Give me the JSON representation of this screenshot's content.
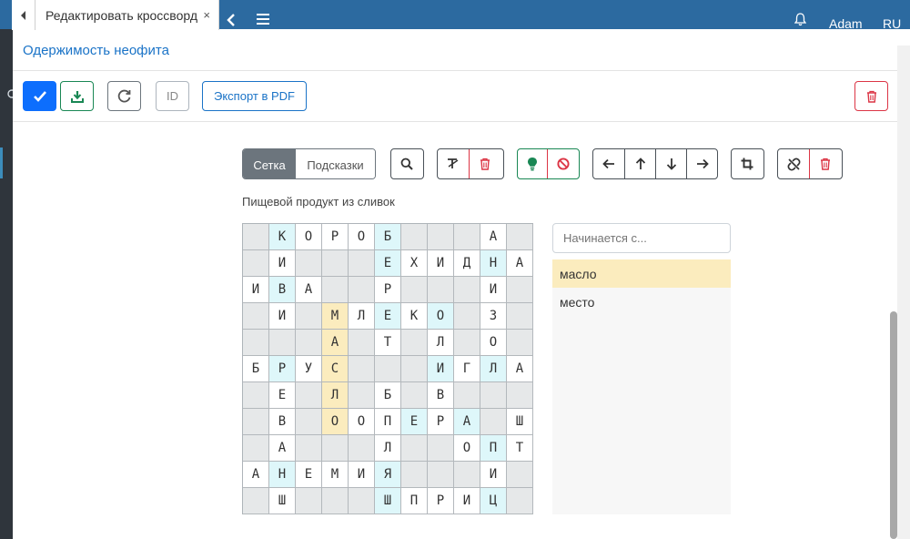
{
  "app": {
    "user": "Adam",
    "lang": "RU"
  },
  "tab": {
    "title": "Редактировать кроссворд",
    "close": "×"
  },
  "panel": {
    "title": "Одержимость неофита"
  },
  "actions": {
    "id_label": "ID",
    "export_label": "Экспорт в PDF"
  },
  "mode_tabs": {
    "grid": "Сетка",
    "hints": "Подсказки"
  },
  "clue": "Пищевой продукт из сливок",
  "search": {
    "placeholder": "Начинается с..."
  },
  "suggestions": [
    {
      "text": "масло",
      "active": true
    },
    {
      "text": "место",
      "active": false
    }
  ],
  "colors": {
    "accent": "#0d6efd",
    "cyan": "#def7fa",
    "yellow": "#fbecbe",
    "block": "#e6e8e9",
    "danger": "#dc3545",
    "success": "#198754"
  },
  "grid": {
    "rows": [
      [
        [
          "",
          ""
        ],
        [
          "К",
          "c"
        ],
        [
          "О",
          "w"
        ],
        [
          "Р",
          "w"
        ],
        [
          "О",
          "w"
        ],
        [
          "Б",
          "c"
        ],
        [
          "",
          ""
        ],
        [
          "",
          ""
        ],
        [
          "",
          ""
        ],
        [
          "А",
          "w"
        ],
        [
          "",
          ""
        ]
      ],
      [
        [
          "",
          ""
        ],
        [
          "И",
          "w"
        ],
        [
          "",
          ""
        ],
        [
          "",
          ""
        ],
        [
          "",
          ""
        ],
        [
          "Е",
          "c"
        ],
        [
          "Х",
          "w"
        ],
        [
          "И",
          "w"
        ],
        [
          "Д",
          "w"
        ],
        [
          "Н",
          "c"
        ],
        [
          "А",
          "w"
        ]
      ],
      [
        [
          "И",
          "w"
        ],
        [
          "В",
          "c"
        ],
        [
          "А",
          "w"
        ],
        [
          "",
          ""
        ],
        [
          "",
          ""
        ],
        [
          "Р",
          "w"
        ],
        [
          "",
          ""
        ],
        [
          "",
          ""
        ],
        [
          "",
          ""
        ],
        [
          "И",
          "w"
        ],
        [
          "",
          ""
        ]
      ],
      [
        [
          "",
          ""
        ],
        [
          "И",
          "w"
        ],
        [
          "",
          ""
        ],
        [
          "М",
          "y"
        ],
        [
          "Л",
          "w"
        ],
        [
          "Е",
          "c"
        ],
        [
          "К",
          "w"
        ],
        [
          "О",
          "c"
        ],
        [
          "",
          ""
        ],
        [
          "З",
          "w"
        ],
        [
          "",
          ""
        ]
      ],
      [
        [
          "",
          ""
        ],
        [
          "",
          ""
        ],
        [
          "",
          ""
        ],
        [
          "А",
          "y"
        ],
        [
          "",
          ""
        ],
        [
          "Т",
          "w"
        ],
        [
          "",
          ""
        ],
        [
          "Л",
          "w"
        ],
        [
          "",
          ""
        ],
        [
          "О",
          "w"
        ],
        [
          "",
          ""
        ]
      ],
      [
        [
          "Б",
          "w"
        ],
        [
          "Р",
          "c"
        ],
        [
          "У",
          "w"
        ],
        [
          "С",
          "y"
        ],
        [
          "",
          ""
        ],
        [
          "",
          ""
        ],
        [
          "",
          ""
        ],
        [
          "И",
          "c"
        ],
        [
          "Г",
          "w"
        ],
        [
          "Л",
          "c"
        ],
        [
          "А",
          "w"
        ]
      ],
      [
        [
          "",
          ""
        ],
        [
          "Е",
          "w"
        ],
        [
          "",
          ""
        ],
        [
          "Л",
          "y"
        ],
        [
          "",
          ""
        ],
        [
          "Б",
          "w"
        ],
        [
          "",
          ""
        ],
        [
          "В",
          "w"
        ],
        [
          "",
          ""
        ],
        [
          "",
          ""
        ],
        [
          "",
          ""
        ]
      ],
      [
        [
          "",
          ""
        ],
        [
          "В",
          "w"
        ],
        [
          "",
          ""
        ],
        [
          "О",
          "y"
        ],
        [
          "О",
          "w"
        ],
        [
          "П",
          "w"
        ],
        [
          "Е",
          "c"
        ],
        [
          "Р",
          "w"
        ],
        [
          "А",
          "c"
        ],
        [
          "",
          ""
        ],
        [
          "Ш",
          "w"
        ]
      ],
      [
        [
          "",
          ""
        ],
        [
          "А",
          "w"
        ],
        [
          "",
          ""
        ],
        [
          "",
          ""
        ],
        [
          "",
          ""
        ],
        [
          "Л",
          "w"
        ],
        [
          "",
          ""
        ],
        [
          "",
          ""
        ],
        [
          "О",
          "w"
        ],
        [
          "П",
          "c"
        ],
        [
          "Т",
          "w"
        ]
      ],
      [
        [
          "А",
          "w"
        ],
        [
          "Н",
          "c"
        ],
        [
          "Е",
          "w"
        ],
        [
          "М",
          "w"
        ],
        [
          "И",
          "w"
        ],
        [
          "Я",
          "c"
        ],
        [
          "",
          ""
        ],
        [
          "",
          ""
        ],
        [
          "",
          ""
        ],
        [
          "И",
          "w"
        ],
        [
          "",
          ""
        ]
      ],
      [
        [
          "",
          ""
        ],
        [
          "Ш",
          "w"
        ],
        [
          "",
          ""
        ],
        [
          "",
          ""
        ],
        [
          "",
          ""
        ],
        [
          "Ш",
          "c"
        ],
        [
          "П",
          "w"
        ],
        [
          "Р",
          "w"
        ],
        [
          "И",
          "w"
        ],
        [
          "Ц",
          "c"
        ],
        [
          "",
          ""
        ]
      ]
    ]
  }
}
